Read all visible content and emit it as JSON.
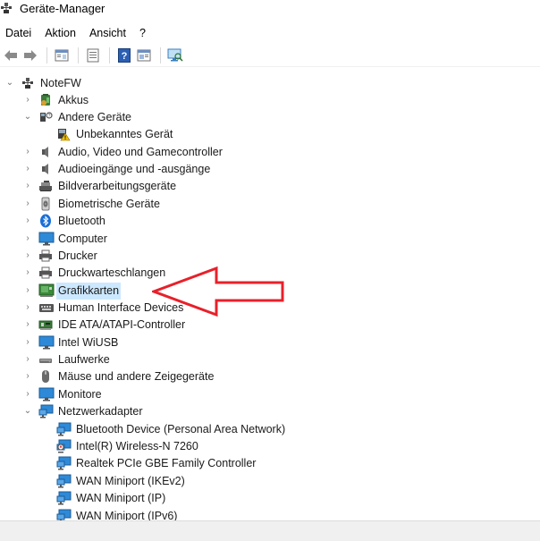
{
  "window": {
    "title": "Geräte-Manager"
  },
  "menu": [
    "Datei",
    "Aktion",
    "Ansicht",
    "?"
  ],
  "toolbar": {
    "buttons": [
      "back-icon",
      "forward-icon",
      "properties-pane-icon",
      "details-icon",
      "help-icon",
      "view-icon",
      "scan-hardware-icon"
    ]
  },
  "tree": {
    "root": "NoteFW",
    "items": [
      {
        "label": "Akkus",
        "icon": "battery-icon",
        "expanded": false
      },
      {
        "label": "Andere Geräte",
        "icon": "unknown-device-icon",
        "expanded": true,
        "children": [
          {
            "label": "Unbekanntes Gerät",
            "icon": "warning-device-icon"
          }
        ]
      },
      {
        "label": "Audio, Video und Gamecontroller",
        "icon": "speaker-icon",
        "expanded": false
      },
      {
        "label": "Audioeingänge und -ausgänge",
        "icon": "speaker-icon",
        "expanded": false
      },
      {
        "label": "Bildverarbeitungsgeräte",
        "icon": "camera-icon",
        "expanded": false
      },
      {
        "label": "Biometrische Geräte",
        "icon": "fingerprint-icon",
        "expanded": false
      },
      {
        "label": "Bluetooth",
        "icon": "bluetooth-icon",
        "expanded": false
      },
      {
        "label": "Computer",
        "icon": "monitor-icon",
        "expanded": false
      },
      {
        "label": "Drucker",
        "icon": "printer-icon",
        "expanded": false
      },
      {
        "label": "Druckwarteschlangen",
        "icon": "printer-icon",
        "expanded": false
      },
      {
        "label": "Grafikkarten",
        "icon": "display-adapter-icon",
        "expanded": false,
        "selected": true
      },
      {
        "label": "Human Interface Devices",
        "icon": "hid-icon",
        "expanded": false
      },
      {
        "label": "IDE ATA/ATAPI-Controller",
        "icon": "controller-icon",
        "expanded": false
      },
      {
        "label": "Intel WiUSB",
        "icon": "monitor-icon",
        "expanded": false
      },
      {
        "label": "Laufwerke",
        "icon": "drive-icon",
        "expanded": false
      },
      {
        "label": "Mäuse und andere Zeigegeräte",
        "icon": "mouse-icon",
        "expanded": false
      },
      {
        "label": "Monitore",
        "icon": "monitor-icon",
        "expanded": false
      },
      {
        "label": "Netzwerkadapter",
        "icon": "network-icon",
        "expanded": true,
        "children": [
          {
            "label": "Bluetooth Device (Personal Area Network)",
            "icon": "network-icon"
          },
          {
            "label": "Intel(R) Wireless-N 7260",
            "icon": "network-warning-icon"
          },
          {
            "label": "Realtek PCIe GBE Family Controller",
            "icon": "network-icon"
          },
          {
            "label": "WAN Miniport (IKEv2)",
            "icon": "network-icon"
          },
          {
            "label": "WAN Miniport (IP)",
            "icon": "network-icon"
          },
          {
            "label": "WAN Miniport (IPv6)",
            "icon": "network-icon"
          }
        ]
      }
    ]
  },
  "annotation": {
    "color": "#e8202a"
  },
  "colors": {
    "selection": "#cce8ff",
    "statusbar": "#f0f0f0"
  }
}
